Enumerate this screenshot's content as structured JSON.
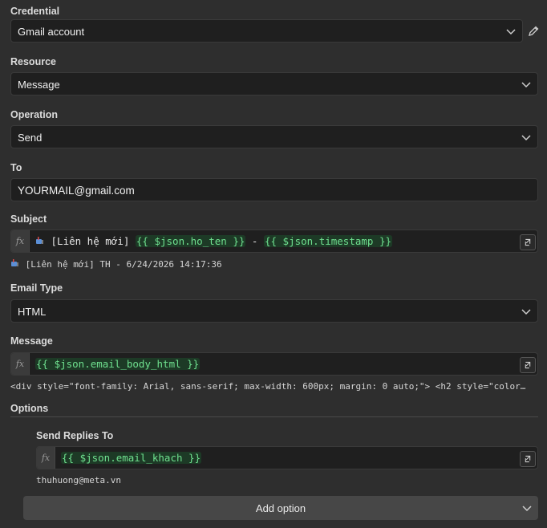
{
  "credential": {
    "label": "Credential",
    "value": "Gmail account"
  },
  "resource": {
    "label": "Resource",
    "value": "Message"
  },
  "operation": {
    "label": "Operation",
    "value": "Send"
  },
  "to": {
    "label": "To",
    "value": "YOURMAIL@gmail.com"
  },
  "subject": {
    "label": "Subject",
    "prefix": "[Liên hệ mới]",
    "expr1": "{{ $json.ho_ten }}",
    "sep": "-",
    "expr2": "{{ $json.timestamp }}",
    "preview": "[Liên hệ mới] TH - 6/24/2026 14:17:36"
  },
  "email_type": {
    "label": "Email Type",
    "value": "HTML"
  },
  "message": {
    "label": "Message",
    "expr": "{{ $json.email_body_html }}",
    "preview": "<div style=\"font-family: Arial, sans-serif; max-width: 600px; margin: 0 auto;\">   <h2 style=\"color…"
  },
  "options": {
    "label": "Options",
    "send_replies_to": {
      "label": "Send Replies To",
      "expr": "{{ $json.email_khach }}",
      "preview": "thuhuong@meta.vn"
    },
    "add_option_label": "Add option"
  },
  "fx_label": "fx",
  "icons": {
    "edit": "pencil-icon",
    "chevron": "chevron-down-icon",
    "expand": "expand-icon",
    "mailbox": "mailbox-icon"
  }
}
